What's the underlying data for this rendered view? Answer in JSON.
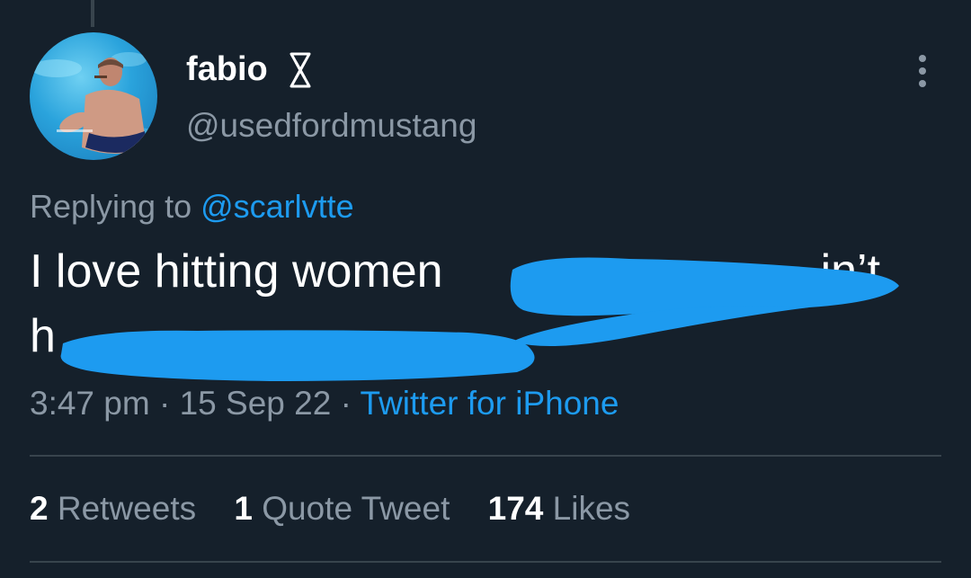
{
  "author": {
    "display_name": "fabio",
    "handle": "@usedfordmustang",
    "badge_icon": "custom-glyph-icon",
    "avatar_description": "profile photo of man in swimming pool"
  },
  "reply": {
    "prefix": "Replying to ",
    "mention": "@scarlvtte"
  },
  "tweet": {
    "line1_visible": "I love hitting women",
    "line1_end_visible": "in’t",
    "line2_start_visible": "h",
    "redaction_color": "#1d9bf0"
  },
  "meta": {
    "time": "3:47 pm",
    "separator": " · ",
    "date": "15 Sep 22",
    "source": "Twitter for iPhone"
  },
  "stats": {
    "retweets_count": "2",
    "retweets_label": "Retweets",
    "quotes_count": "1",
    "quotes_label": "Quote Tweet",
    "likes_count": "174",
    "likes_label": "Likes"
  },
  "colors": {
    "background": "#15202b",
    "text_primary": "#ffffff",
    "text_secondary": "#8b98a5",
    "accent": "#1d9bf0",
    "divider": "#38444d"
  }
}
